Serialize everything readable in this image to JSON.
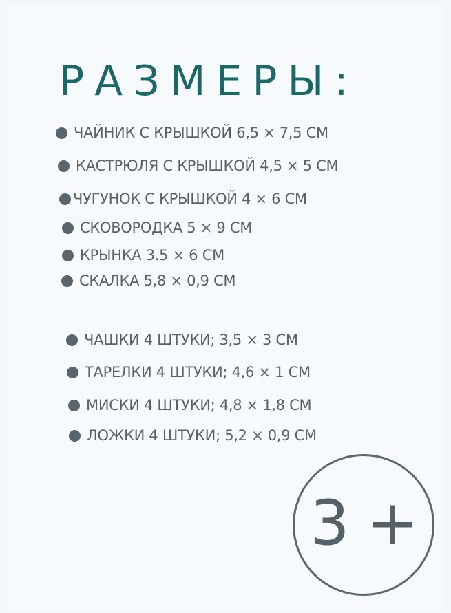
{
  "title": "РАЗМЕРЫ:",
  "group1": [
    "ЧАЙНИК С КРЫШКОЙ 6,5 × 7,5 СМ",
    "КАСТРЮЛЯ С КРЫШКОЙ 4,5 × 5 СМ",
    "ЧУГУНОК С КРЫШКОЙ 4 × 6 СМ",
    "СКОВОРОДКА 5 × 9 СМ",
    "КРЫНКА 3.5 × 6 СМ",
    "СКАЛКА 5,8 × 0,9 СМ"
  ],
  "group2": [
    "ЧАШКИ 4 ШТУКИ; 3,5 × 3 СМ",
    "ТАРЕЛКИ 4 ШТУКИ; 4,6 × 1 СМ",
    "МИСКИ 4 ШТУКИ; 4,8 × 1,8 СМ",
    "ЛОЖКИ 4 ШТУКИ; 5,2 × 0,9 СМ"
  ],
  "age_badge": "3 +",
  "colors": {
    "title": "#1d6767",
    "text": "#5b6167",
    "bullet": "#5a646c",
    "background": "#f6fafc"
  }
}
